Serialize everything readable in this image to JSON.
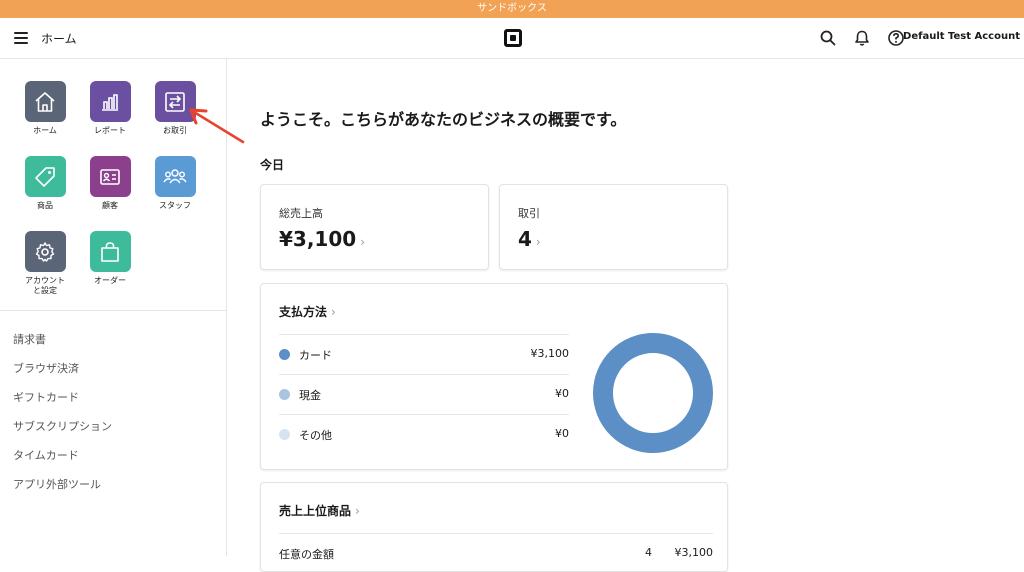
{
  "banner": {
    "text": "サンドボックス"
  },
  "topbar": {
    "breadcrumb": "ホーム",
    "account": "Default Test Account",
    "icons": [
      "menu-icon",
      "square-logo-icon",
      "search-icon",
      "bell-icon",
      "help-icon"
    ]
  },
  "apps": [
    {
      "label": "ホーム",
      "color": "#5a6577",
      "icon": "home-icon"
    },
    {
      "label": "レポート",
      "color": "#6b4fa0",
      "icon": "bar-chart-icon"
    },
    {
      "label": "お取引",
      "color": "#6b4fa0",
      "icon": "transactions-icon"
    },
    {
      "label": "商品",
      "color": "#3dbb9b",
      "icon": "tag-icon"
    },
    {
      "label": "顧客",
      "color": "#8c3f8c",
      "icon": "contact-card-icon"
    },
    {
      "label": "スタッフ",
      "color": "#5b9bd5",
      "icon": "team-icon"
    },
    {
      "label": "アカウントと設定",
      "color": "#5a6577",
      "icon": "gear-icon"
    },
    {
      "label": "オーダー",
      "color": "#3dbb9b",
      "icon": "shopping-bag-icon"
    }
  ],
  "nav_links": [
    "請求書",
    "ブラウザ決済",
    "ギフトカード",
    "サブスクリプション",
    "タイムカード",
    "アプリ外部ツール"
  ],
  "main": {
    "welcome": "ようこそ。こちらがあなたのビジネスの概要です。",
    "today": "今日",
    "gross_sales": {
      "label": "総売上高",
      "value": "¥3,100",
      "chevron": "›"
    },
    "transactions": {
      "label": "取引",
      "value": "4",
      "chevron": "›"
    },
    "payment": {
      "title": "支払方法",
      "chevron": "›",
      "rows": [
        {
          "name": "カード",
          "amount": "¥3,100",
          "color": "#5b8fc5"
        },
        {
          "name": "現金",
          "amount": "¥0",
          "color": "#a9c4df"
        },
        {
          "name": "その他",
          "amount": "¥0",
          "color": "#d6e3f0"
        }
      ]
    },
    "top_items": {
      "title": "売上上位商品",
      "chevron": "›",
      "rows": [
        {
          "name": "任意の金額",
          "qty": "4",
          "amount": "¥3,100"
        }
      ]
    }
  },
  "chart_data": {
    "type": "pie",
    "categories": [
      "カード",
      "現金",
      "その他"
    ],
    "values": [
      3100,
      0,
      0
    ],
    "colors": [
      "#5b8fc5",
      "#a9c4df",
      "#d6e3f0"
    ]
  },
  "annotation": {
    "color": "#e8432e"
  }
}
